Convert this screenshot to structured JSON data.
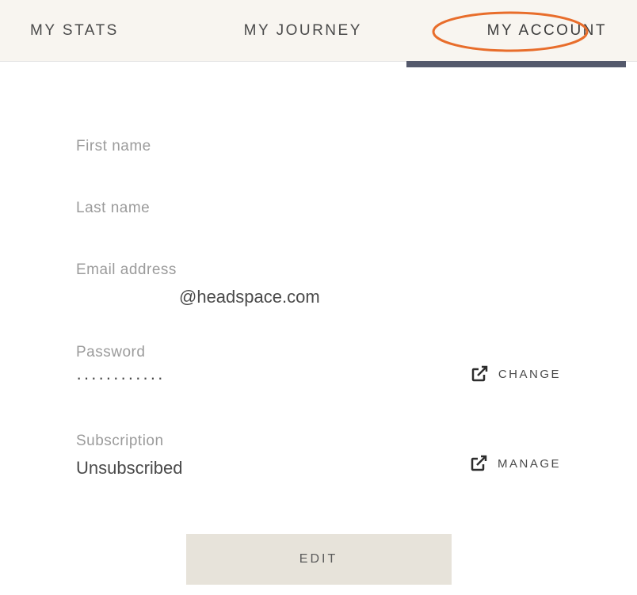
{
  "nav": {
    "tab1": "MY STATS",
    "tab2": "MY JOURNEY",
    "tab3": "MY ACCOUNT"
  },
  "fields": {
    "firstName": {
      "label": "First name",
      "value": ""
    },
    "lastName": {
      "label": "Last name",
      "value": ""
    },
    "email": {
      "label": "Email address",
      "value": "@headspace.com"
    },
    "password": {
      "label": "Password",
      "value": "············",
      "action": "CHANGE"
    },
    "subscription": {
      "label": "Subscription",
      "value": "Unsubscribed",
      "action": "MANAGE"
    }
  },
  "editButton": "EDIT"
}
